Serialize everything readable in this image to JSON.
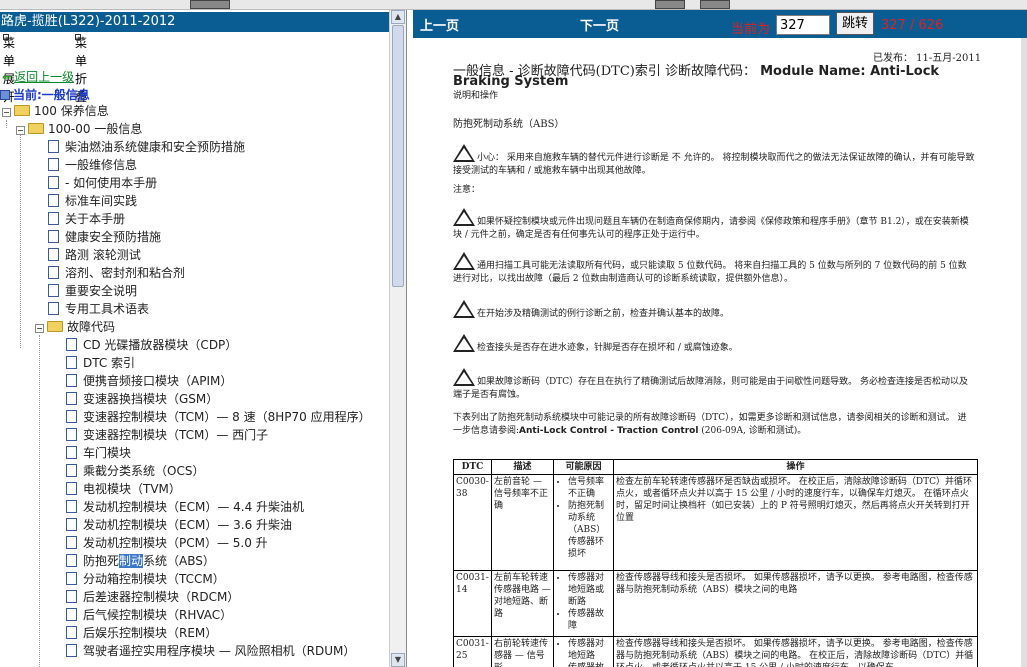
{
  "left_pane": {
    "title": "路虎-揽胜(L322)-2011-2012",
    "menu_expand": "菜单展开",
    "menu_collapse": "菜单折叠",
    "back": "返回上一级",
    "current": "当前:一般信息",
    "tree": [
      {
        "label": "100 保养信息",
        "icon": "folder-icon"
      },
      {
        "label": "100-00 一般信息",
        "icon": "folder-icon"
      },
      {
        "label": "柴油燃油系统健康和安全预防措施",
        "icon": "document-icon"
      },
      {
        "label": "一般维修信息",
        "icon": "document-icon"
      },
      {
        "label": "- 如何使用本手册",
        "icon": "document-icon"
      },
      {
        "label": "标准车间实践",
        "icon": "document-icon"
      },
      {
        "label": "关于本手册",
        "icon": "document-icon"
      },
      {
        "label": "健康安全预防措施",
        "icon": "document-icon"
      },
      {
        "label": "路测 滚轮测试",
        "icon": "document-icon"
      },
      {
        "label": "溶剂、密封剂和粘合剂",
        "icon": "document-icon"
      },
      {
        "label": "重要安全说明",
        "icon": "document-icon"
      },
      {
        "label": "专用工具术语表",
        "icon": "document-icon"
      },
      {
        "label": "故障代码",
        "icon": "folder-icon"
      },
      {
        "label": "CD 光碟播放器模块（CDP）",
        "icon": "document-icon"
      },
      {
        "label": "DTC 索引",
        "icon": "document-icon"
      },
      {
        "label": "便携音频接口模块（APIM）",
        "icon": "document-icon"
      },
      {
        "label": "变速器换挡模块（GSM）",
        "icon": "document-icon"
      },
      {
        "label": "变速器控制模块（TCM）— 8 速（8HP70 应用程序）",
        "icon": "document-icon"
      },
      {
        "label": "变速器控制模块（TCM）— 西门子",
        "icon": "document-icon"
      },
      {
        "label": "车门模块",
        "icon": "document-icon"
      },
      {
        "label": "乘截分类系统（OCS）",
        "icon": "document-icon"
      },
      {
        "label": "电视模块（TVM）",
        "icon": "document-icon"
      },
      {
        "label": "发动机控制模块（ECM）— 4.4 升柴油机",
        "icon": "document-icon"
      },
      {
        "label": "发动机控制模块（ECM）— 3.6 升柴油",
        "icon": "document-icon"
      },
      {
        "label": "发动机控制模块（PCM）— 5.0 升",
        "icon": "document-icon"
      },
      {
        "label": "防抱死制动系统（ABS）",
        "icon": "document-icon",
        "selected_part": "制动"
      },
      {
        "label": "分动箱控制模块（TCCM）",
        "icon": "document-icon"
      },
      {
        "label": "后差速器控制模块（RDCM）",
        "icon": "document-icon"
      },
      {
        "label": "后气候控制模块（RHVAC）",
        "icon": "document-icon"
      },
      {
        "label": "后娱乐控制模块（REM）",
        "icon": "document-icon"
      },
      {
        "label": "驾驶者遥控实用程序模块 — 风险照相机（RDUM）",
        "icon": "document-icon"
      }
    ]
  },
  "right_pane": {
    "prev": "上一页",
    "next": "下一页",
    "current_label": "当前为",
    "page_value": "327",
    "go": "跳转",
    "page_count": "327 / 626",
    "doc": {
      "published": "已发布：  11-五月-2011",
      "heading": "一般信息 - 诊断故障代码(DTC)索引 诊断故障代码：",
      "heading_bold": "Module Name: Anti-Lock",
      "heading2": "Braking System",
      "sub": "说明和操作",
      "section": "防抱死制动系统（ABS）",
      "caution": "小心： 采用来自施救车辆的替代元件进行诊断是 不 允许的。 将控制模块取而代之的做法无法保证故障的确认，并有可能导致接受测试的车辆和 / 或施救车辆中出现其他故障。",
      "notes_label": "注意：",
      "note1": "如果怀疑控制模块或元件出现问题且车辆仍在制造商保修期内，请参阅《保修政策和程序手册》（章节 B1.2），或在安装新模块 / 元件之前，确定是否有任何事先认可的程序正处于运行中。",
      "note2": "通用扫描工具可能无法读取所有代码，或只能读取 5 位数代码。 将来自扫描工具的 5 位数与所列的 7 位数代码的前 5 位数进行对比，以找出故障（最后 2 位数由制造商认可的诊断系统读取，提供额外信息）。",
      "note3": "在开始涉及精确测试的例行诊断之前，检查并确认基本的故障。",
      "note4": "检查接头是否存在进水迹象，针脚是否存在损坏和 / 或腐蚀迹象。",
      "note5": "如果故障诊断码（DTC）存在且在执行了精确测试后故障消除，则可能是由于间歇性问题导致。 务必检查连接是否松动以及端子是否有腐蚀。",
      "intro": "下表列出了防抱死制动系统模块中可能记录的所有故障诊断码（DTC），如需更多诊断和测试信息，请参阅相关的诊断和测试。 进一步信息请参阅:",
      "intro_bold": "Anti-Lock Control - Traction Control",
      "intro_tail": " (206-09A, 诊断和测试)。",
      "table_headers": [
        "DTC",
        "描述",
        "可能原因",
        "操作"
      ],
      "table_rows": [
        {
          "dtc": "C0030-38",
          "desc": "左前音轮 — 信号频率不正确",
          "causes": [
            "信号频率不正确",
            "防抱死制动系统（ABS）传感器环损坏"
          ],
          "action": "检查左前车轮转速传感器环是否缺齿或损坏。 在校正后，清除故障诊断码（DTC）并循环点火，或者循环点火并以高于 15 公里 / 小时的速度行车，以确保车灯熄灭。 在循环点火时，留足时间让换档杆（如已安装）上的 P 符号照明灯熄灭，然后再将点火开关转到打开位置"
        },
        {
          "dtc": "C0031-14",
          "desc": "左前车轮转速传感器电路 — 对地短路、断路",
          "causes": [
            "传感器对地短路或断路",
            "传感器故障"
          ],
          "action": "检查传感器导线和接头是否损坏。 如果传感器损坏，请予以更换。 参考电路图，检查传感器与防抱死制动系统（ABS）模块之间的电路"
        },
        {
          "dtc": "C0031-25",
          "desc": "右前轮转速传感器 — 信号形",
          "causes": [
            "传感器对地短路",
            "传感器故"
          ],
          "action": "检查传感器导线和接头是否损坏。 如果传感器损坏，请予以更换。 参考电路图，检查传感器与防抱死制动系统（ABS）模块之间的电路。 在校正后，清除故障诊断码（DTC）并循环点火，或者循环点火并以高于 15 公里 / 小时的速度行车，以确保车"
        }
      ]
    }
  }
}
